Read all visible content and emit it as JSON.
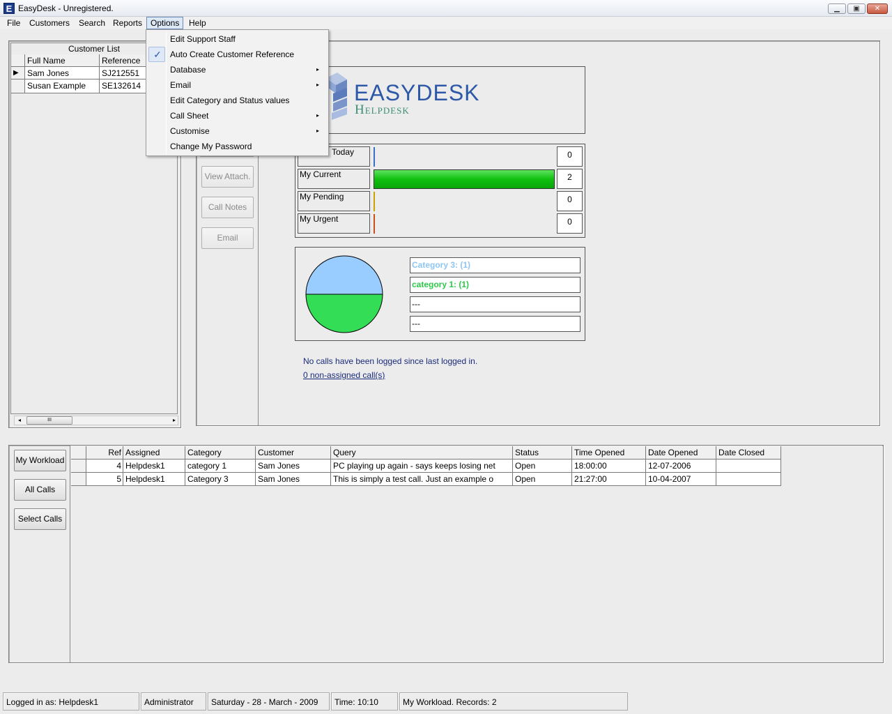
{
  "window": {
    "app_icon": "E",
    "title": "EasyDesk - Unregistered.",
    "controls": {
      "minimize": "minimize-icon",
      "maximize": "maximize-icon",
      "close": "close-icon"
    }
  },
  "menubar": {
    "file": "File",
    "customers": "Customers",
    "search": "Search",
    "reports": "Reports",
    "options": "Options",
    "help": "Help"
  },
  "options_menu": {
    "items": [
      "Edit Support Staff",
      "Auto Create Customer Reference",
      "Database",
      "Email",
      "Edit Category and Status values",
      "Call Sheet",
      "Customise",
      "Change My Password"
    ],
    "checked_item": "Auto Create Customer Reference",
    "submenu_arrow": "▸"
  },
  "customer_list": {
    "title": "Customer List",
    "columns": [
      "Full Name",
      "Reference"
    ],
    "rows": [
      {
        "name": "Sam Jones",
        "ref": "SJ212551"
      },
      {
        "name": "Susan Example",
        "ref": "SE132614"
      }
    ],
    "scroll_thumb": "III"
  },
  "side_buttons": {
    "view_attach": "View Attach.",
    "call_notes": "Call Notes",
    "email": "Email"
  },
  "logo": {
    "line1": "EASYDESK",
    "line2": "Helpdesk"
  },
  "stats": [
    {
      "label": "Logged Today",
      "visible_label": "Today",
      "count": "0",
      "fill": 0,
      "color": "#3a6fc9"
    },
    {
      "label": "My Current",
      "count": "2",
      "fill": 1.0,
      "color": "#10c010"
    },
    {
      "label": "My Pending",
      "count": "0",
      "fill": 0,
      "color": "#c9a400"
    },
    {
      "label": "My Urgent",
      "count": "0",
      "fill": 0,
      "color": "#c9501a"
    }
  ],
  "categories": [
    {
      "label": "Category 3:  (1)",
      "color": "#8ec5f5"
    },
    {
      "label": "category 1:  (1)",
      "color": "#2ec94a"
    },
    {
      "label": "---",
      "color": "#000000"
    },
    {
      "label": "---",
      "color": "#000000"
    }
  ],
  "pie": {
    "slices": [
      {
        "label": "Category 3",
        "value": 1,
        "color": "#99ccff"
      },
      {
        "label": "category 1",
        "value": 1,
        "color": "#33dd55"
      }
    ]
  },
  "messages": {
    "last_login": "No calls have been logged since last logged in.",
    "non_assigned": "0 non-assigned call(s)"
  },
  "call_buttons": {
    "my_workload": "My Workload",
    "all_calls": "All Calls",
    "select_calls": "Select Calls"
  },
  "calls": {
    "columns": [
      "Ref",
      "Assigned",
      "Category",
      "Customer",
      "Query",
      "Status",
      "Time Opened",
      "Date Opened",
      "Date Closed"
    ],
    "rows": [
      {
        "ref": "4",
        "assigned": "Helpdesk1",
        "category": "category 1",
        "customer": "Sam Jones",
        "query": "PC playing up again - says keeps losing net",
        "status": "Open",
        "time": "18:00:00",
        "date_opened": "12-07-2006",
        "date_closed": ""
      },
      {
        "ref": "5",
        "assigned": "Helpdesk1",
        "category": "Category 3",
        "customer": "Sam Jones",
        "query": "This is simply a test call.  Just an example o",
        "status": "Open",
        "time": "21:27:00",
        "date_opened": "10-04-2007",
        "date_closed": ""
      }
    ]
  },
  "statusbar": {
    "logged_in": "Logged in as: Helpdesk1",
    "role": "Administrator",
    "date": "Saturday - 28 - March - 2009",
    "time": "Time: 10:10",
    "records": "My Workload.  Records: 2"
  }
}
